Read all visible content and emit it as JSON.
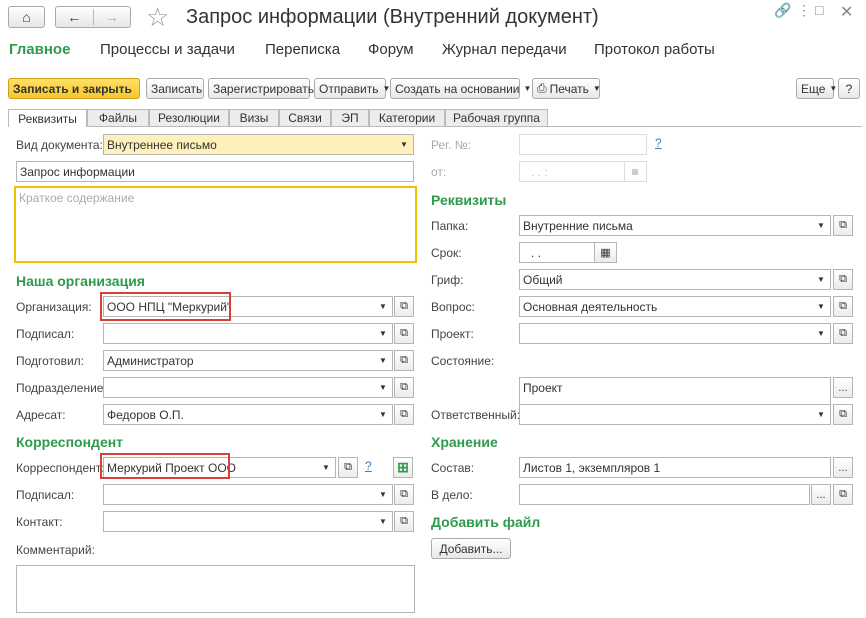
{
  "window": {
    "title": "Запрос информации (Внутренний документ)"
  },
  "sections": [
    "Главное",
    "Процессы и задачи",
    "Переписка",
    "Форум",
    "Журнал передачи",
    "Протокол работы"
  ],
  "toolbar": {
    "save_close": "Записать и закрыть",
    "save": "Записать",
    "register": "Зарегистрировать",
    "send": "Отправить",
    "create_based": "Создать на основании",
    "print": "Печать",
    "more": "Еще",
    "help": "?"
  },
  "tabs": [
    "Реквизиты",
    "Файлы",
    "Резолюции",
    "Визы",
    "Связи",
    "ЭП",
    "Категории",
    "Рабочая группа"
  ],
  "left": {
    "doc_type_label": "Вид документа:",
    "doc_type_value": "Внутреннее письмо",
    "title_value": "Запрос информации",
    "summary_placeholder": "Краткое содержание",
    "our_org_header": "Наша организация",
    "org_label": "Организация:",
    "org_value": "ООО НПЦ \"Меркурий\"",
    "signed_label": "Подписал:",
    "signed_value": "",
    "prepared_label": "Подготовил:",
    "prepared_value": "Администратор",
    "dept_label": "Подразделение:",
    "dept_value": "",
    "addressee_label": "Адресат:",
    "addressee_value": "Федоров О.П.",
    "corr_header": "Корреспондент",
    "corr_label": "Корреспондент:",
    "corr_value": "Меркурий Проект ООО",
    "corr_signed_label": "Подписал:",
    "contact_label": "Контакт:",
    "comment_label": "Комментарий:"
  },
  "right": {
    "reg_no_label": "Рег. №:",
    "from_label": "от:",
    "date_placeholder": ".   .      :",
    "rekv_header": "Реквизиты",
    "folder_label": "Папка:",
    "folder_value": "Внутренние письма",
    "deadline_label": "Срок:",
    "deadline_value": ".   .",
    "grif_label": "Гриф:",
    "grif_value": "Общий",
    "question_label": "Вопрос:",
    "question_value": "Основная деятельность",
    "project_label": "Проект:",
    "project_value": "",
    "state_label": "Состояние:",
    "state_value": "Проект",
    "responsible_label": "Ответственный:",
    "responsible_value": "",
    "storage_header": "Хранение",
    "composition_label": "Состав:",
    "composition_value": "Листов 1, экземпляров 1",
    "tocase_label": "В дело:",
    "tocase_value": "",
    "addfile_header": "Добавить файл",
    "add_button": "Добавить..."
  },
  "icons": {
    "home": "home-icon",
    "back": "arrow-left-icon",
    "forward": "arrow-right-icon",
    "star": "star-icon",
    "link": "link-icon",
    "menu": "menu-icon",
    "maximize": "maximize-icon",
    "close": "close-icon",
    "printer": "printer-icon",
    "calendar": "calendar-icon",
    "open": "open-icon",
    "add": "plus-icon"
  },
  "colors": {
    "accent_green": "#2d9b4b",
    "primary_button": "#f5c72a",
    "highlight": "#d9403a",
    "yellow_field": "#fdf0bb",
    "summary_border": "#f0c000"
  }
}
